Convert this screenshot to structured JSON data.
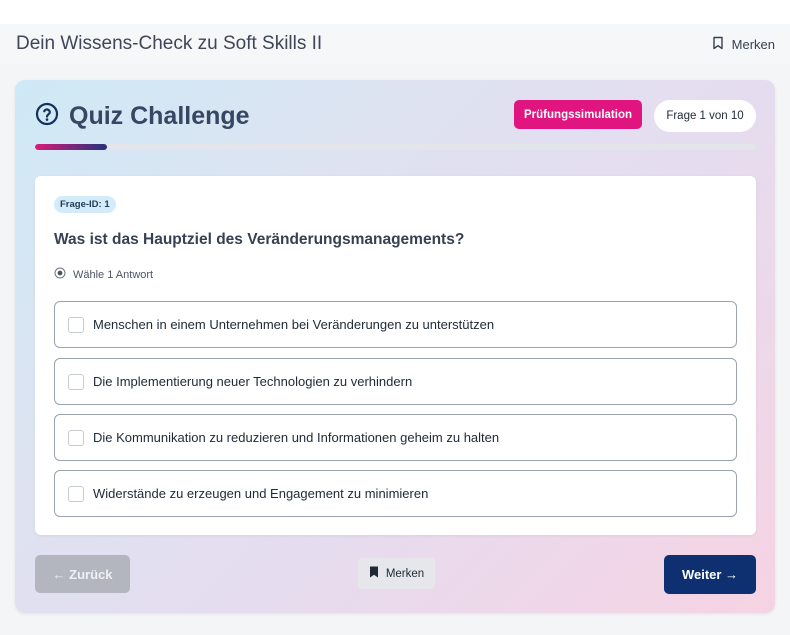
{
  "header": {
    "title": "Dein Wissens-Check zu Soft Skills II",
    "bookmark_label": "Merken",
    "bookmark_icon": "bookmark-outline-icon"
  },
  "quiz": {
    "title": "Quiz Challenge",
    "title_icon": "question-circle-icon",
    "mode_badge": "Prüfungssimulation",
    "question_counter": "Frage 1 von 10",
    "progress_fraction": 0.1,
    "colors": {
      "accent_pink": "#e0157f",
      "primary_navy": "#0e3070"
    }
  },
  "question": {
    "id_label": "Frage-ID: 1",
    "text": "Was ist das Hauptziel des Veränderungsmanagements?",
    "hint": "Wähle 1 Antwort",
    "answers": [
      {
        "label": "Menschen in einem Unternehmen bei Veränderungen zu unterstützen",
        "checked": false
      },
      {
        "label": "Die Implementierung neuer Technologien zu verhindern",
        "checked": false
      },
      {
        "label": "Die Kommunikation zu reduzieren und Informationen geheim zu halten",
        "checked": false
      },
      {
        "label": "Widerstände zu erzeugen und Engagement zu minimieren",
        "checked": false
      }
    ]
  },
  "footer": {
    "back_label": "← Zurück",
    "mark_label": "Merken",
    "next_label": "Weiter →"
  }
}
